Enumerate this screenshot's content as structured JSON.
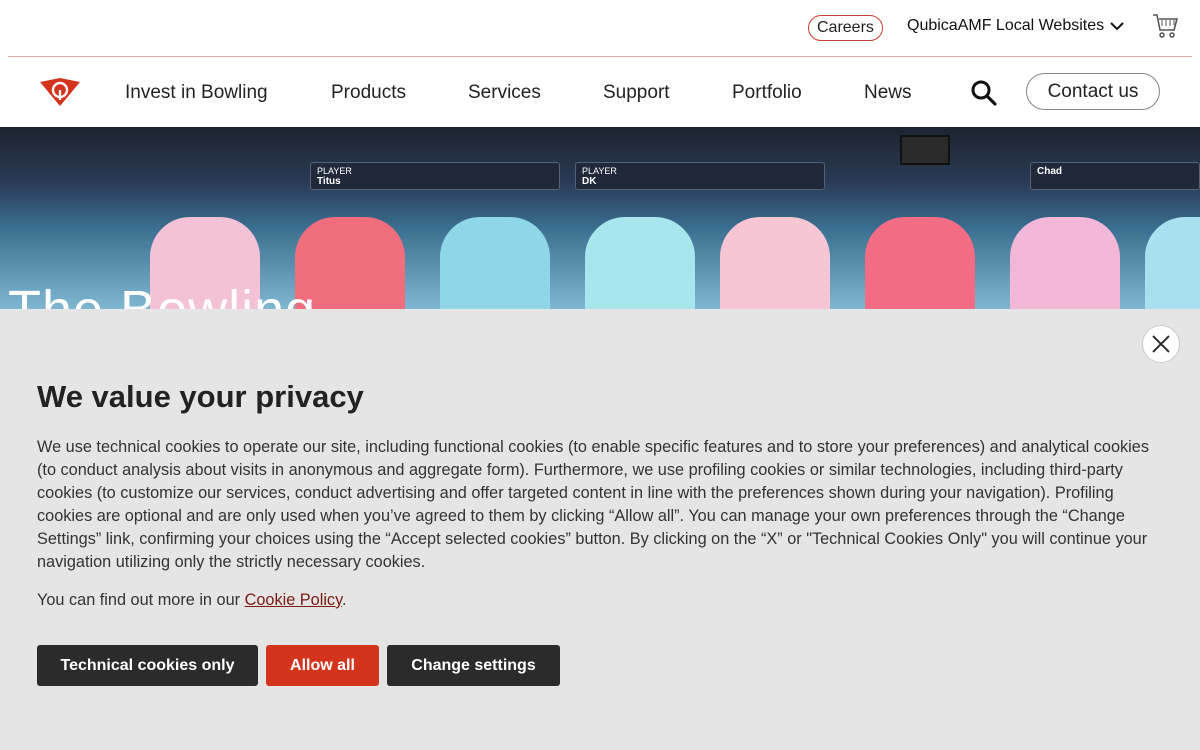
{
  "topbar": {
    "careers_label": "Careers",
    "local_sites_label": "QubicaAMF Local Websites"
  },
  "nav": {
    "items": [
      {
        "label": "Invest in Bowling"
      },
      {
        "label": "Products"
      },
      {
        "label": "Services"
      },
      {
        "label": "Support"
      },
      {
        "label": "Portfolio"
      },
      {
        "label": "News"
      }
    ],
    "contact_label": "Contact us"
  },
  "hero": {
    "title": "The Bowling",
    "screens": [
      {
        "tag": "PLAYER",
        "name": "Titus"
      },
      {
        "tag": "PLAYER",
        "name": "DK"
      },
      {
        "tag": "",
        "name": "Chad"
      }
    ]
  },
  "cookie": {
    "title": "We value your privacy",
    "body": "We use technical cookies to operate our site, including functional cookies (to enable specific features and to store your preferences) and analytical cookies (to conduct analysis about visits in anonymous and aggregate form). Furthermore, we use profiling cookies or similar technologies, including third-party cookies (to customize our services, conduct advertising and offer targeted content in line with the preferences shown during your navigation). Profiling cookies are optional and are only used when you’ve agreed to them by clicking “Allow all”. You can manage your own preferences through the “Change Settings” link, confirming your choices using the “Accept selected cookies” button. By clicking on the “X” or \"Technical Cookies Only\" you will continue your navigation utilizing only the strictly necessary cookies.",
    "more_prefix": "You can find out more in our ",
    "more_link": "Cookie Policy",
    "more_suffix": ".",
    "buttons": {
      "technical": "Technical cookies only",
      "allow_all": "Allow all",
      "change": "Change settings"
    }
  },
  "colors": {
    "brand_red": "#d4341c",
    "dark_button": "#2b2b2b",
    "panel_bg": "#e5e5e5"
  }
}
